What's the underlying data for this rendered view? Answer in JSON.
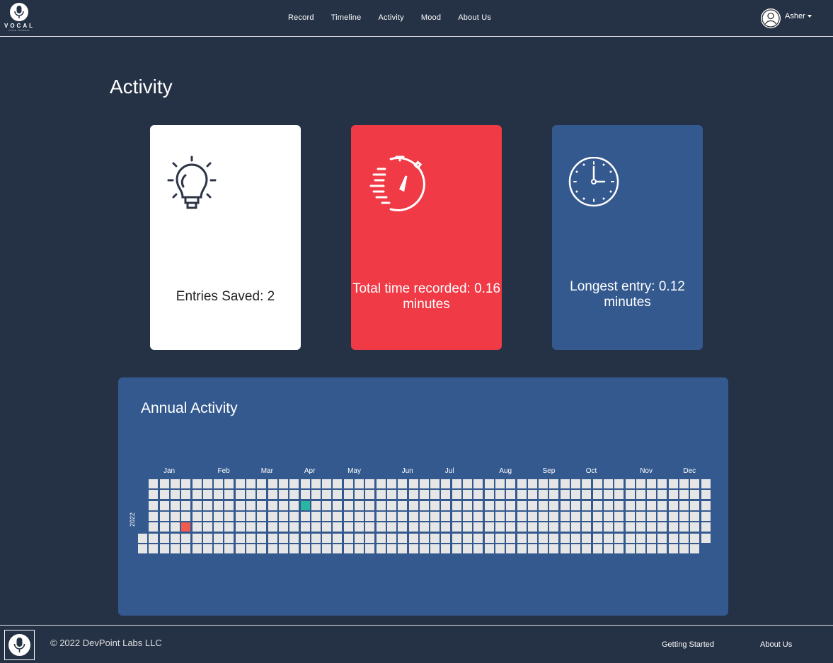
{
  "nav": {
    "brand": "VOCAL",
    "tagline": "VOICE JOURNAL",
    "links": [
      "Record",
      "Timeline",
      "Activity",
      "Mood",
      "About Us"
    ],
    "user_name": "Asher"
  },
  "page_title": "Activity",
  "cards": {
    "entries": {
      "label": "Entries Saved: 2",
      "icon": "lightbulb-icon",
      "color": "#ffffff"
    },
    "total_time": {
      "label": "Total time recorded: 0.16 minutes",
      "icon": "stopwatch-icon",
      "color": "#f03a46"
    },
    "longest": {
      "label": "Longest entry: 0.12 minutes",
      "icon": "clock-icon",
      "color": "#34598f"
    }
  },
  "annual": {
    "title": "Annual Activity",
    "year": "2022",
    "months": [
      "Jan",
      "Feb",
      "Mar",
      "Apr",
      "May",
      "Jun",
      "Jul",
      "Aug",
      "Sep",
      "Oct",
      "Nov",
      "Dec"
    ],
    "highlighted_days": [
      {
        "date": "2022-01-28",
        "color": "#f15b50"
      },
      {
        "date": "2022-04-13",
        "color": "#2bb5a3"
      }
    ],
    "cell_color": "#e6e6e6"
  },
  "footer": {
    "copyright": "© 2022 DevPoint Labs LLC",
    "links": [
      "Getting Started",
      "About Us"
    ]
  }
}
